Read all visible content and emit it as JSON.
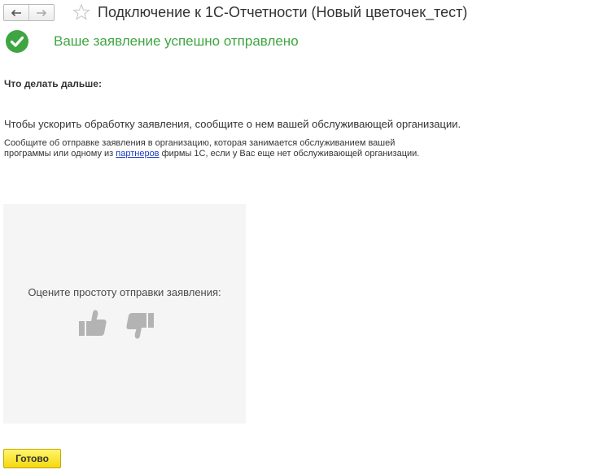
{
  "header": {
    "title": "Подключение к 1С-Отчетности (Новый цветочек_тест)",
    "back_icon": "arrow-left-icon",
    "forward_icon": "arrow-right-icon",
    "favorite_icon": "star-icon"
  },
  "status": {
    "message": "Ваше заявление успешно отправлено",
    "icon": "checkmark-circle-icon",
    "color": "#3fa542"
  },
  "next_steps": {
    "heading": "Что делать дальше:",
    "main_text": "Чтобы ускорить обработку заявления, сообщите о нем вашей обслуживающей организации.",
    "detail_before": "Сообщите об отправке заявления в организацию, которая занимается обслуживанием вашей программы или одному из ",
    "detail_link": "партнеров",
    "detail_after": " фирмы 1С, если у Вас еще нет обслуживающей организации."
  },
  "rating": {
    "label": "Оцените простоту отправки заявления:",
    "like_icon": "thumbs-up-icon",
    "dislike_icon": "thumbs-down-icon"
  },
  "actions": {
    "done_label": "Готово",
    "done_color": "#f4d80e"
  }
}
